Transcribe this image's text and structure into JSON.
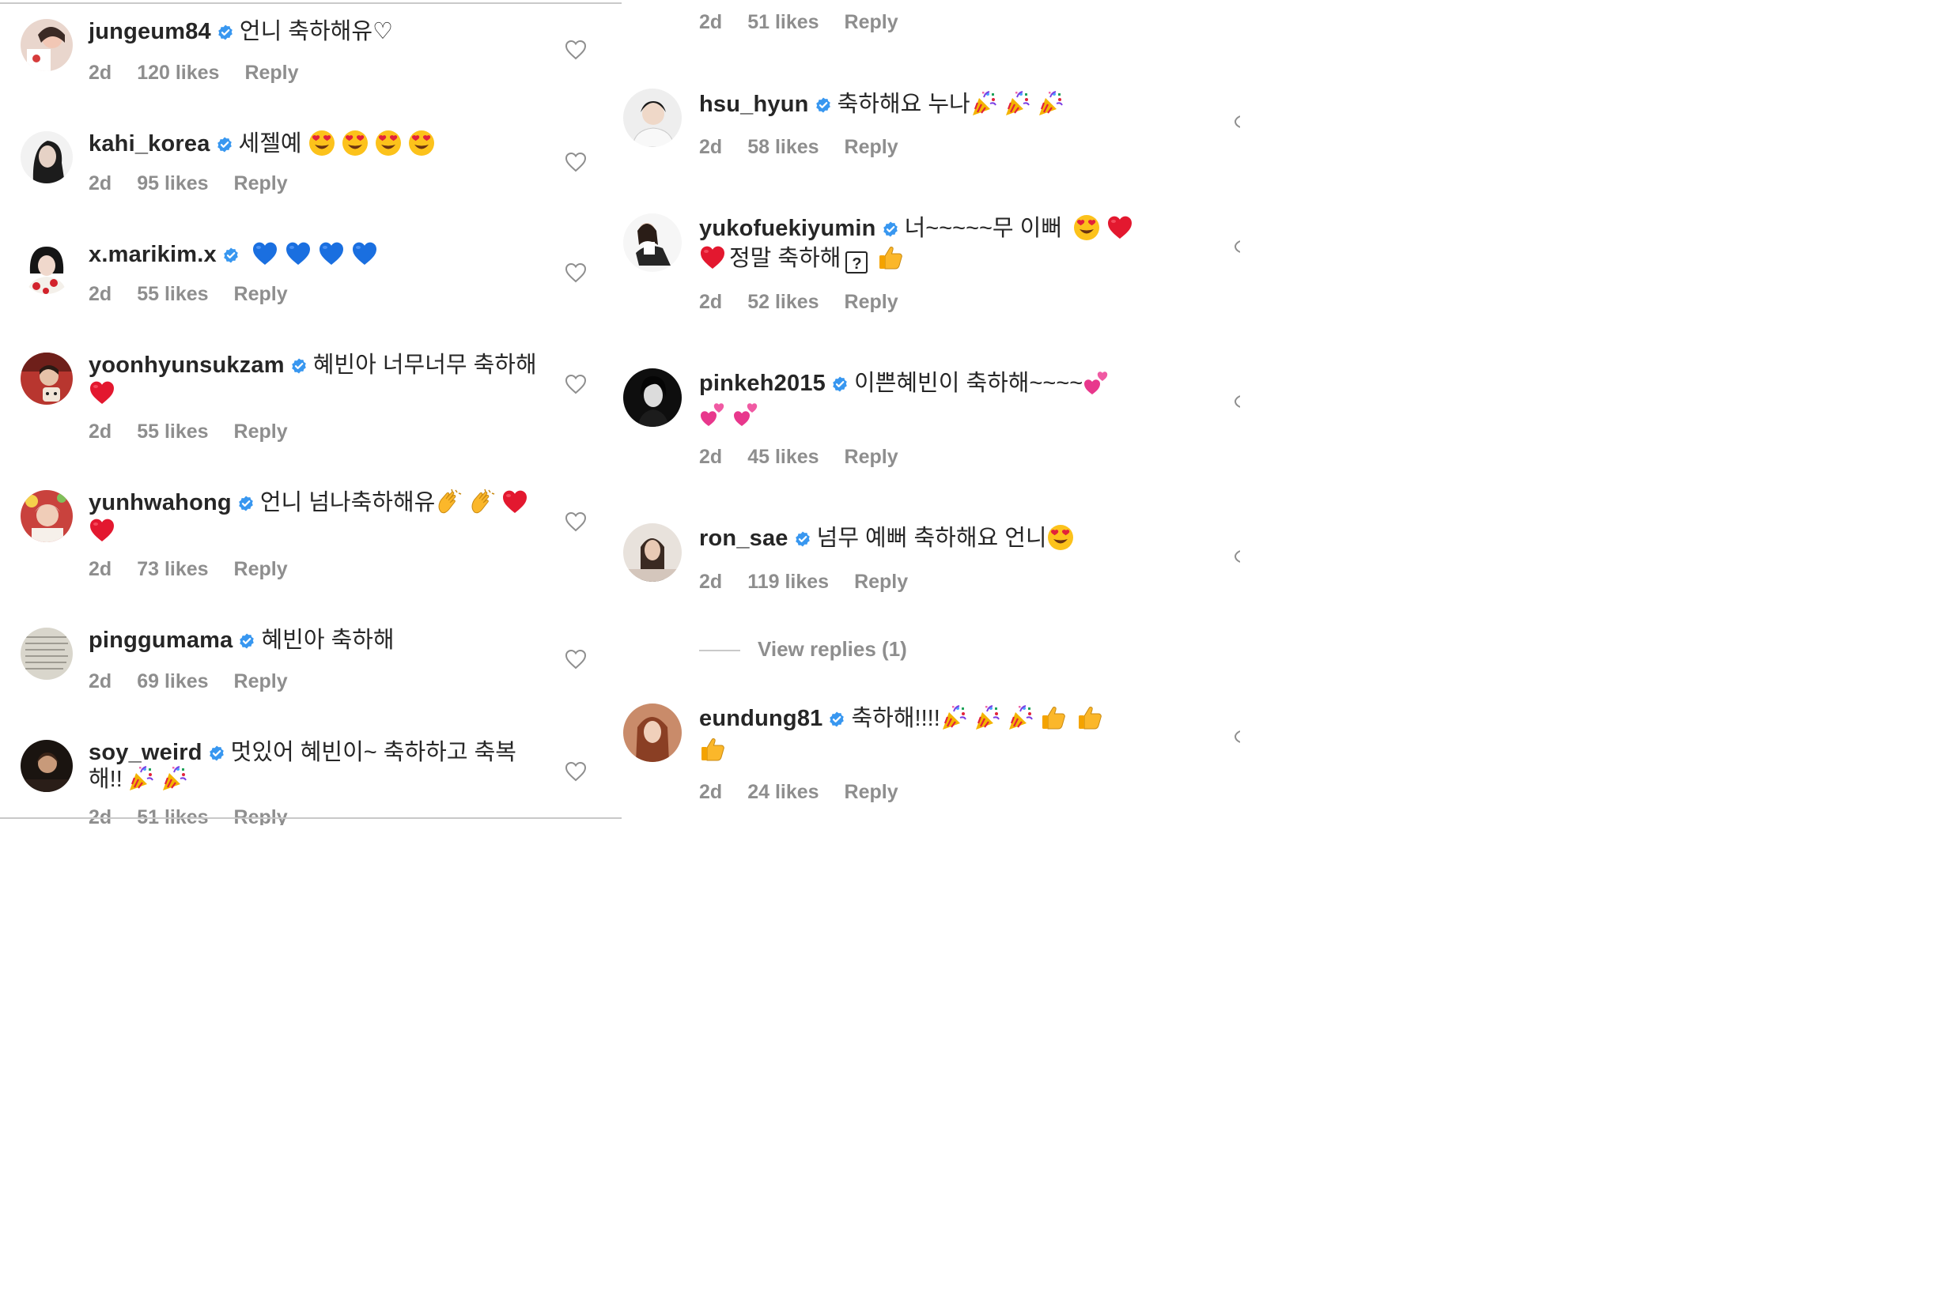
{
  "left_column": [
    {
      "username": "jungeum84",
      "text": "언니 축하해유♡",
      "emoji": [],
      "time": "2d",
      "likes": "120 likes",
      "reply": "Reply"
    },
    {
      "username": "kahi_korea",
      "text": "세젤예",
      "emoji": [
        "heart-eyes",
        "heart-eyes",
        "heart-eyes",
        "heart-eyes"
      ],
      "time": "2d",
      "likes": "95 likes",
      "reply": "Reply"
    },
    {
      "username": "x.marikim.x",
      "text": "",
      "emoji": [
        "blue-heart",
        "blue-heart",
        "blue-heart",
        "blue-heart"
      ],
      "time": "2d",
      "likes": "55 likes",
      "reply": "Reply"
    },
    {
      "username": "yoonhyunsukzam",
      "text": "혜빈아 너무너무 축하해",
      "emoji": [
        "red-heart"
      ],
      "time": "2d",
      "likes": "55 likes",
      "reply": "Reply"
    },
    {
      "username": "yunhwahong",
      "text": "언니 넘나축하해유",
      "emoji": [
        "clap",
        "clap",
        "red-heart",
        "red-heart"
      ],
      "time": "2d",
      "likes": "73 likes",
      "reply": "Reply"
    },
    {
      "username": "pinggumama",
      "text": "혜빈아 축하해",
      "emoji": [],
      "time": "2d",
      "likes": "69 likes",
      "reply": "Reply"
    },
    {
      "username": "soy_weird",
      "text": "멋있어 혜빈이~ 축하하고 축복",
      "text2": "해!!",
      "emoji": [
        "party-popper",
        "party-popper"
      ],
      "time": "2d",
      "likes": "51 likes",
      "reply": "Reply"
    }
  ],
  "right_column": {
    "top_meta": {
      "time": "2d",
      "likes": "51 likes",
      "reply": "Reply"
    },
    "comments": [
      {
        "username": "hsu_hyun",
        "text": "축하해요 누나",
        "emoji": [
          "party-popper",
          "party-popper",
          "party-popper"
        ],
        "time": "2d",
        "likes": "58 likes",
        "reply": "Reply"
      },
      {
        "username": "yukofuekiyumin",
        "text": "너~~~~~무 이뻐",
        "text2": "정말 축하해",
        "qmark": "?",
        "emoji": [
          "heart-eyes",
          "red-heart",
          "red-heart",
          "thumbs-up"
        ],
        "time": "2d",
        "likes": "52 likes",
        "reply": "Reply"
      },
      {
        "username": "pinkeh2015",
        "text": "이쁜혜빈이 축하해~~~~",
        "emoji": [
          "two-hearts",
          "two-hearts",
          "two-hearts"
        ],
        "time": "2d",
        "likes": "45 likes",
        "reply": "Reply"
      },
      {
        "username": "ron_sae",
        "text": "넘무 예뻐 축하해요 언니",
        "emoji": [
          "heart-eyes"
        ],
        "time": "2d",
        "likes": "119 likes",
        "reply": "Reply"
      },
      {
        "username": "eundung81",
        "text": "축하해!!!!",
        "emoji": [
          "party-popper",
          "party-popper",
          "party-popper",
          "thumbs-up",
          "thumbs-up",
          "thumbs-up"
        ],
        "time": "2d",
        "likes": "24 likes",
        "reply": "Reply"
      }
    ],
    "view_replies": "View replies (1)"
  },
  "colors": {
    "text": "#262626",
    "meta": "#8e8e8e",
    "verified": "#3897f0",
    "divider": "#c9c9c9"
  }
}
